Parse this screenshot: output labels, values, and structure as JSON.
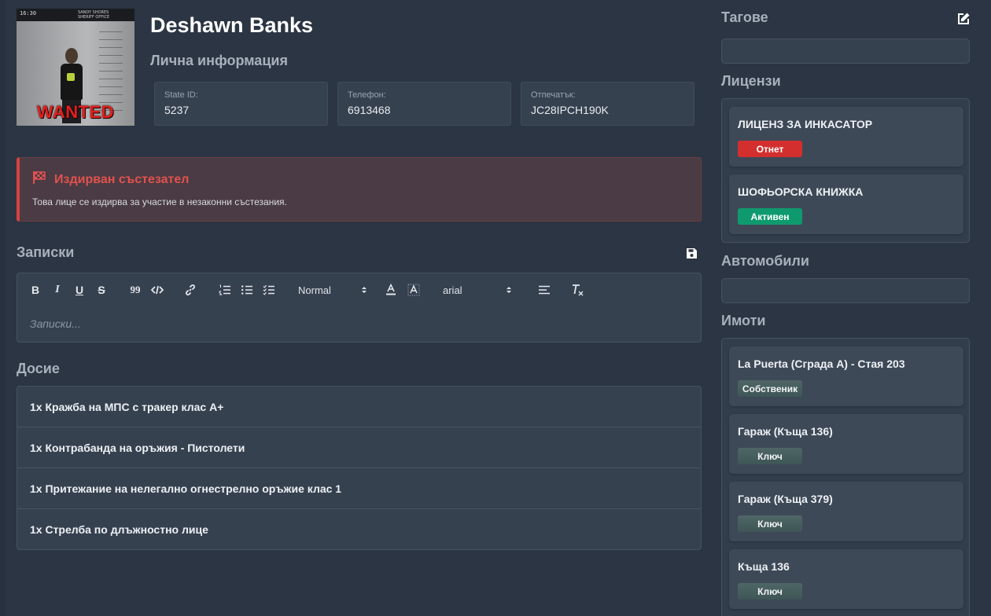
{
  "profile": {
    "photo": {
      "timecode": "16:30",
      "caption": "SANDY SHORES SHERIFF OFFICE",
      "overlay": "WANTED"
    },
    "name": "Deshawn Banks",
    "section_title": "Лична информация",
    "fields": [
      {
        "label": "State ID:",
        "value": "5237"
      },
      {
        "label": "Телефон:",
        "value": "6913468"
      },
      {
        "label": "Отпечатък:",
        "value": "JC28IPCH190K"
      }
    ]
  },
  "alert": {
    "icon": "checkered-flag-icon",
    "title": "Издирван състезател",
    "text": "Това лице се издирва за участие в незаконни състезания.",
    "color": "#d7413f"
  },
  "notes": {
    "title": "Записки",
    "placeholder": "Записки...",
    "toolbar": {
      "bold": "B",
      "italic": "I",
      "underline": "U",
      "strike": "S",
      "quote": "99",
      "header_select": "Normal",
      "font_select": "arial"
    }
  },
  "dossier": {
    "title": "Досие",
    "items": [
      "1x Кражба на МПС с тракер клас А+",
      "1x Контрабанда на оръжия - Пистолети",
      "1x Притежание на нелегално огнестрелно оръжие клас 1",
      "1x Стрелба по длъжностно лице"
    ]
  },
  "sidebar": {
    "tags_title": "Тагове",
    "licenses_title": "Лицензи",
    "licenses": [
      {
        "name": "ЛИЦЕНЗ ЗА ИНКАСАТОР",
        "status": "Отнет",
        "status_color": "#d32f2f"
      },
      {
        "name": "ШОФЬОРСКА КНИЖКА",
        "status": "Активен",
        "status_color": "#0f9a6e"
      }
    ],
    "vehicles_title": "Автомобили",
    "properties_title": "Имоти",
    "properties": [
      {
        "name": "La Puerta (Сграда А) - Стая 203",
        "role": "Собственик"
      },
      {
        "name": "Гараж (Къща 136)",
        "role": "Ключ"
      },
      {
        "name": "Гараж (Къща 379)",
        "role": "Ключ"
      },
      {
        "name": "Къща 136",
        "role": "Ключ"
      }
    ]
  }
}
